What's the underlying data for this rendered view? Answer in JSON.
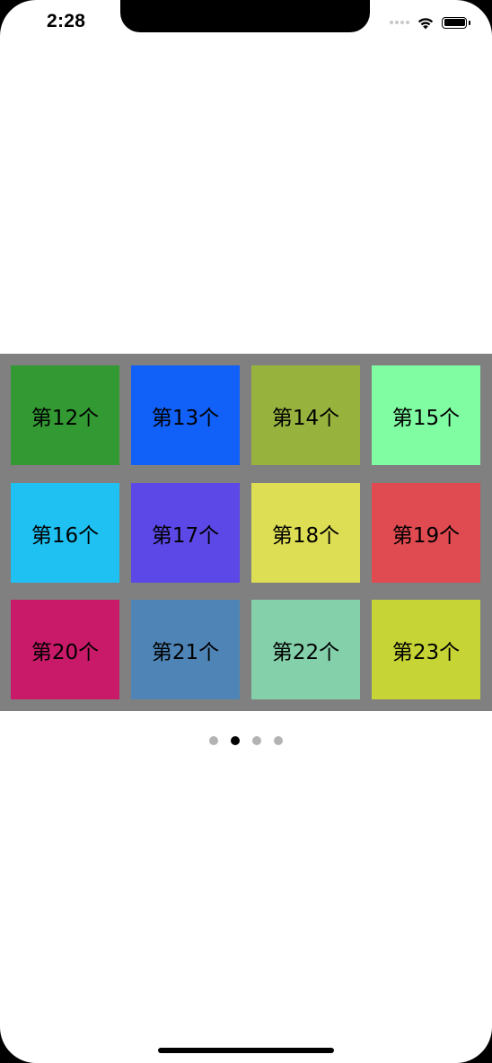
{
  "status_bar": {
    "time": "2:28",
    "signal_icon": "cellular-signal-dots",
    "wifi_icon": "wifi-icon",
    "battery_icon": "battery-icon"
  },
  "grid": {
    "background_color": "#808080",
    "items": [
      {
        "label": "第12个",
        "color": "#339933"
      },
      {
        "label": "第13个",
        "color": "#1160F8"
      },
      {
        "label": "第14个",
        "color": "#97B33E"
      },
      {
        "label": "第15个",
        "color": "#80FCA3"
      },
      {
        "label": "第16个",
        "color": "#1FC1F2"
      },
      {
        "label": "第17个",
        "color": "#5C48E6"
      },
      {
        "label": "第18个",
        "color": "#DEDE55"
      },
      {
        "label": "第19个",
        "color": "#E04A51"
      },
      {
        "label": "第20个",
        "color": "#C81A68"
      },
      {
        "label": "第21个",
        "color": "#4F85B6"
      },
      {
        "label": "第22个",
        "color": "#84D0AA"
      },
      {
        "label": "第23个",
        "color": "#C6D435"
      }
    ]
  },
  "pagination": {
    "page_count": 4,
    "current_page": 2,
    "active_color": "#000000",
    "inactive_color": "#B3B3B3"
  }
}
